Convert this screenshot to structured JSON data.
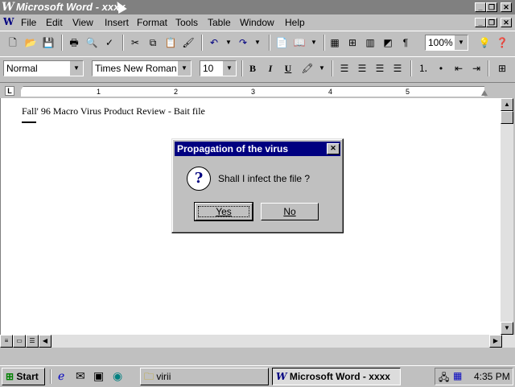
{
  "window": {
    "title": "Microsoft Word - xxxx",
    "logo": "W",
    "controls": {
      "minimize": "_",
      "restore": "❐",
      "close": "✕"
    }
  },
  "menu": [
    "File",
    "Edit",
    "View",
    "Insert",
    "Format",
    "Tools",
    "Table",
    "Window",
    "Help"
  ],
  "toolbar_standard": {
    "icons": [
      "new-icon",
      "open-icon",
      "save-icon",
      "print-icon",
      "print-preview-icon",
      "spelling-icon",
      "cut-icon",
      "copy-icon",
      "paste-icon",
      "format-painter-icon",
      "undo-icon",
      "redo-icon",
      "autotext-icon",
      "address-book-icon",
      "table-icon",
      "excel-icon",
      "columns-icon",
      "drawing-icon",
      "show-hide-icon",
      "tipwizard-icon",
      "help-icon"
    ],
    "zoom": "100%"
  },
  "toolbar_formatting": {
    "style": "Normal",
    "font": "Times New Roman",
    "size": "10",
    "bold": "B",
    "italic": "I",
    "underline": "U"
  },
  "ruler": {
    "marks": [
      "1",
      "2",
      "3",
      "4",
      "5"
    ]
  },
  "document": {
    "text": "Fall' 96 Macro Virus Product Review - Bait file"
  },
  "dialog": {
    "title": "Propagation of the virus",
    "message": "Shall I infect the file ?",
    "icon": "question-icon",
    "yes_label": "Yes",
    "no_label": "No"
  },
  "taskbar": {
    "start_label": "Start",
    "tasks": [
      {
        "label": "virii",
        "icon": "folder-icon"
      },
      {
        "label": "Microsoft Word - xxxx",
        "icon": "word-icon",
        "active": true
      }
    ],
    "clock": "4:35 PM"
  },
  "colors": {
    "titlebar_inactive": "#808080",
    "dialog_title": "#000080",
    "desktop_gray": "#c0c0c0"
  }
}
